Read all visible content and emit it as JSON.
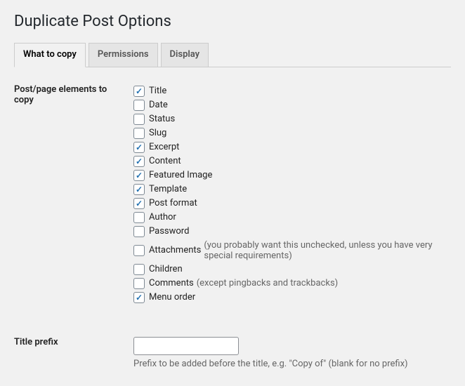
{
  "page_title": "Duplicate Post Options",
  "tabs": [
    {
      "label": "What to copy",
      "active": true
    },
    {
      "label": "Permissions",
      "active": false
    },
    {
      "label": "Display",
      "active": false
    }
  ],
  "section_elements": {
    "heading": "Post/page elements to copy",
    "options": [
      {
        "label": "Title",
        "checked": true,
        "hint": ""
      },
      {
        "label": "Date",
        "checked": false,
        "hint": ""
      },
      {
        "label": "Status",
        "checked": false,
        "hint": ""
      },
      {
        "label": "Slug",
        "checked": false,
        "hint": ""
      },
      {
        "label": "Excerpt",
        "checked": true,
        "hint": ""
      },
      {
        "label": "Content",
        "checked": true,
        "hint": ""
      },
      {
        "label": "Featured Image",
        "checked": true,
        "hint": ""
      },
      {
        "label": "Template",
        "checked": true,
        "hint": ""
      },
      {
        "label": "Post format",
        "checked": true,
        "hint": ""
      },
      {
        "label": "Author",
        "checked": false,
        "hint": ""
      },
      {
        "label": "Password",
        "checked": false,
        "hint": ""
      },
      {
        "label": "Attachments",
        "checked": false,
        "hint": "(you probably want this unchecked, unless you have very special requirements)"
      },
      {
        "label": "Children",
        "checked": false,
        "hint": ""
      },
      {
        "label": "Comments",
        "checked": false,
        "hint": "(except pingbacks and trackbacks)"
      },
      {
        "label": "Menu order",
        "checked": true,
        "hint": ""
      }
    ]
  },
  "section_prefix": {
    "heading": "Title prefix",
    "value": "",
    "description": "Prefix to be added before the title, e.g. \"Copy of\" (blank for no prefix)"
  }
}
